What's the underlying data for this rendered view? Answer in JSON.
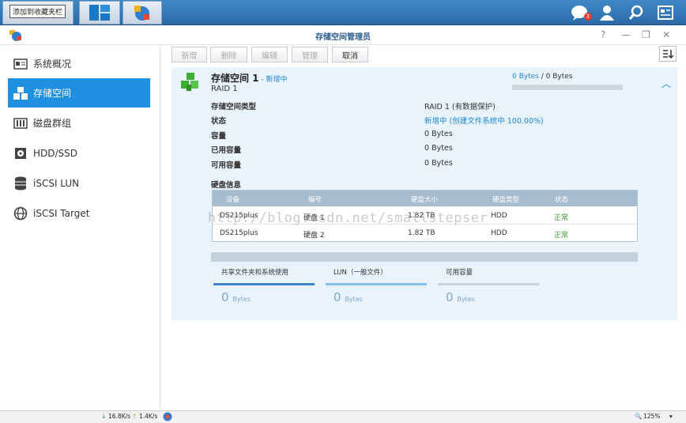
{
  "taskbar": {
    "tooltip": "添加到收藏夹栏",
    "notification_count": "3"
  },
  "window": {
    "title": "存储空间管理员"
  },
  "sidebar": {
    "items": [
      {
        "label": "系统概况",
        "icon": "overview-icon"
      },
      {
        "label": "存储空间",
        "icon": "storage-cubes-icon",
        "active": true
      },
      {
        "label": "磁盘群组",
        "icon": "disk-group-icon"
      },
      {
        "label": "HDD/SSD",
        "icon": "hdd-icon"
      },
      {
        "label": "iSCSI LUN",
        "icon": "database-icon"
      },
      {
        "label": "iSCSI Target",
        "icon": "globe-icon"
      }
    ]
  },
  "toolbar": {
    "create": "新增",
    "delete": "删除",
    "edit": "编辑",
    "manage": "管理",
    "cancel": "取消"
  },
  "volume": {
    "name": "存储空间 1",
    "separator": " - ",
    "status": "新增中",
    "raid": "RAID 1",
    "capacity_used": "0 Bytes",
    "capacity_sep": " / ",
    "capacity_total": "0 Bytes",
    "details": [
      {
        "label": "存储空间类型",
        "value": "RAID 1 (有数据保护)"
      },
      {
        "label": "状态",
        "value": "新增中 (创建文件系统中 100.00%)"
      },
      {
        "label": "容量",
        "value": "0 Bytes"
      },
      {
        "label": "已用容量",
        "value": "0 Bytes"
      },
      {
        "label": "可用容量",
        "value": "0 Bytes"
      }
    ]
  },
  "disks": {
    "title": "硬盘信息",
    "columns": [
      "设备",
      "编号",
      "硬盘大小",
      "硬盘类型",
      "状态"
    ],
    "rows": [
      [
        "DS215plus",
        "硬盘 1",
        "1.82 TB",
        "HDD",
        "正常"
      ],
      [
        "DS215plus",
        "硬盘 2",
        "1.82 TB",
        "HDD",
        "正常"
      ]
    ]
  },
  "usage": [
    {
      "label": "共享文件夹和系统使用",
      "value": "0",
      "unit": "Bytes",
      "color": "#3f86c6"
    },
    {
      "label": "LUN（一般文件）",
      "value": "0",
      "unit": "Bytes",
      "color": "#86c0ec"
    },
    {
      "label": "可用容量",
      "value": "0",
      "unit": "Bytes",
      "color": "#c9d2da"
    }
  ],
  "watermark": "http://blog.csdn.net/smallstepser",
  "statusbar": {
    "download": "16.8K/s",
    "upload": "1.4K/s",
    "zoom": "125%"
  },
  "colors": {
    "accent": "#1f8fe0",
    "link": "#1f86d6",
    "ok": "#3a9b2c"
  }
}
